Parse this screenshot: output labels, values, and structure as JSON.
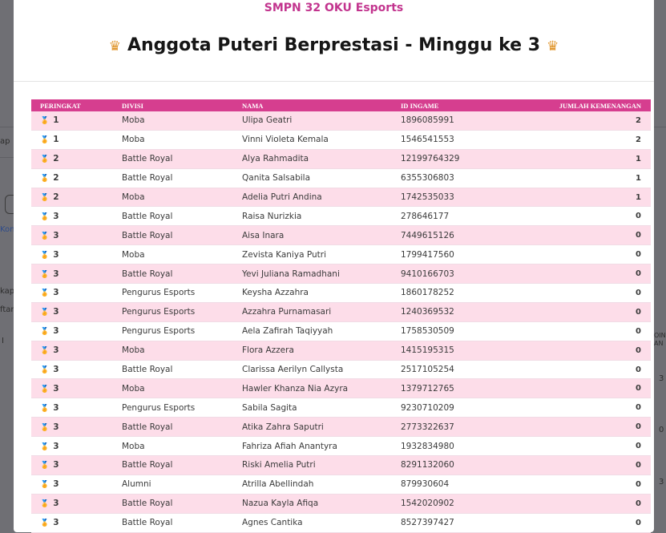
{
  "modal": {
    "school": "SMPN 32 OKU Esports",
    "title": "Anggota Puteri Berprestasi - Minggu ke 3",
    "crown_icon": "crown-icon"
  },
  "background": {
    "frag_ap": "ap",
    "frag_kon": "Kon",
    "frag_kap": "kap",
    "frag_ftar": "ftar",
    "frag_i": "I",
    "frag_oin": "OIN",
    "frag_an": "AN",
    "frag_3a": "3",
    "frag_0": "0",
    "frag_3b": "3"
  },
  "table": {
    "headers": [
      "PERINGKAT",
      "DIVISI",
      "NAMA",
      "ID INGAME",
      "JUMLAH KEMENANGAN"
    ],
    "rows": [
      {
        "rank": "1",
        "medal": "gold-medal-icon",
        "divisi": "Moba",
        "nama": "Ulipa Geatri",
        "id": "1896085991",
        "wins": "2"
      },
      {
        "rank": "1",
        "medal": "gold-medal-icon",
        "divisi": "Moba",
        "nama": "Vinni Violeta Kemala",
        "id": "1546541553",
        "wins": "2"
      },
      {
        "rank": "2",
        "medal": "silver-medal-icon",
        "divisi": "Battle Royal",
        "nama": "Alya Rahmadita",
        "id": "12199764329",
        "wins": "1"
      },
      {
        "rank": "2",
        "medal": "silver-medal-icon",
        "divisi": "Battle Royal",
        "nama": "Qanita Salsabila",
        "id": "6355306803",
        "wins": "1"
      },
      {
        "rank": "2",
        "medal": "silver-medal-icon",
        "divisi": "Moba",
        "nama": "Adelia Putri Andina",
        "id": "1742535033",
        "wins": "1"
      },
      {
        "rank": "3",
        "medal": "bronze-medal-icon",
        "divisi": "Battle Royal",
        "nama": "Raisa Nurizkia",
        "id": "278646177",
        "wins": "0"
      },
      {
        "rank": "3",
        "medal": "bronze-medal-icon",
        "divisi": "Battle Royal",
        "nama": "Aisa Inara",
        "id": "7449615126",
        "wins": "0"
      },
      {
        "rank": "3",
        "medal": "bronze-medal-icon",
        "divisi": "Moba",
        "nama": "Zevista Kaniya Putri",
        "id": "1799417560",
        "wins": "0"
      },
      {
        "rank": "3",
        "medal": "bronze-medal-icon",
        "divisi": "Battle Royal",
        "nama": "Yevi Juliana Ramadhani",
        "id": "9410166703",
        "wins": "0"
      },
      {
        "rank": "3",
        "medal": "bronze-medal-icon",
        "divisi": "Pengurus Esports",
        "nama": "Keysha Azzahra",
        "id": "1860178252",
        "wins": "0"
      },
      {
        "rank": "3",
        "medal": "bronze-medal-icon",
        "divisi": "Pengurus Esports",
        "nama": "Azzahra Purnamasari",
        "id": "1240369532",
        "wins": "0"
      },
      {
        "rank": "3",
        "medal": "bronze-medal-icon",
        "divisi": "Pengurus Esports",
        "nama": "Aela Zafirah Taqiyyah",
        "id": "1758530509",
        "wins": "0"
      },
      {
        "rank": "3",
        "medal": "bronze-medal-icon",
        "divisi": "Moba",
        "nama": "Flora Azzera",
        "id": "1415195315",
        "wins": "0"
      },
      {
        "rank": "3",
        "medal": "bronze-medal-icon",
        "divisi": "Battle Royal",
        "nama": "Clarissa Aerilyn Callysta",
        "id": "2517105254",
        "wins": "0"
      },
      {
        "rank": "3",
        "medal": "bronze-medal-icon",
        "divisi": "Moba",
        "nama": "Hawler Khanza Nia Azyra",
        "id": "1379712765",
        "wins": "0"
      },
      {
        "rank": "3",
        "medal": "bronze-medal-icon",
        "divisi": "Pengurus Esports",
        "nama": "Sabila Sagita",
        "id": "9230710209",
        "wins": "0"
      },
      {
        "rank": "3",
        "medal": "bronze-medal-icon",
        "divisi": "Battle Royal",
        "nama": "Atika Zahra Saputri",
        "id": "2773322637",
        "wins": "0"
      },
      {
        "rank": "3",
        "medal": "bronze-medal-icon",
        "divisi": "Moba",
        "nama": "Fahriza Afiah Anantyra",
        "id": "1932834980",
        "wins": "0"
      },
      {
        "rank": "3",
        "medal": "bronze-medal-icon",
        "divisi": "Battle Royal",
        "nama": "Riski Amelia Putri",
        "id": "8291132060",
        "wins": "0"
      },
      {
        "rank": "3",
        "medal": "bronze-medal-icon",
        "divisi": "Alumni",
        "nama": "Atrilla Abellindah",
        "id": "879930604",
        "wins": "0"
      },
      {
        "rank": "3",
        "medal": "bronze-medal-icon",
        "divisi": "Battle Royal",
        "nama": "Nazua Kayla Afiqa",
        "id": "1542020902",
        "wins": "0"
      },
      {
        "rank": "3",
        "medal": "bronze-medal-icon",
        "divisi": "Battle Royal",
        "nama": "Agnes Cantika",
        "id": "8527397427",
        "wins": "0"
      }
    ]
  },
  "colors": {
    "header_bg": "#d63e8f",
    "school_text": "#c2348e",
    "row_alt": "#fddde9"
  }
}
